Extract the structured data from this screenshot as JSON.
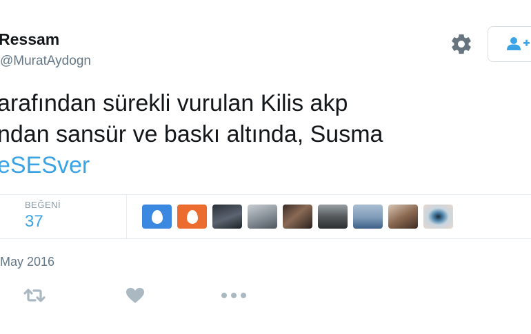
{
  "profile": {
    "display_name": "Ressam",
    "handle": "@MuratAydogn"
  },
  "tweet": {
    "lines": [
      "arafından sürekli vurulan Kilis akp",
      "ndan sansür ve baskı altında, Susma"
    ],
    "hashtag": "eSESver"
  },
  "stats": {
    "likes_label": "BEĞENİ",
    "likes_count": "37"
  },
  "liker_avatars": [
    {
      "name": "default-egg-blue",
      "color": "#3b88e0"
    },
    {
      "name": "default-egg-orange",
      "color": "#ec6c2f"
    },
    {
      "name": "photo-man-with-car",
      "color": "#43484f"
    },
    {
      "name": "photo-man-light",
      "color": "#9aa3ab"
    },
    {
      "name": "photo-group",
      "color": "#5f4a3f"
    },
    {
      "name": "photo-man-street",
      "color": "#56595c"
    },
    {
      "name": "photo-sea-sunset",
      "color": "#7e9bb8"
    },
    {
      "name": "photo-man-bearded",
      "color": "#8c6a52"
    },
    {
      "name": "photo-eye-closeup",
      "color": "#5f8fb0"
    }
  ],
  "date": "May 2016",
  "colors": {
    "link_blue": "#3aa3e6",
    "secondary_text": "#657786",
    "icon_gray": "#aab8c2",
    "border": "#e6ecf0"
  }
}
